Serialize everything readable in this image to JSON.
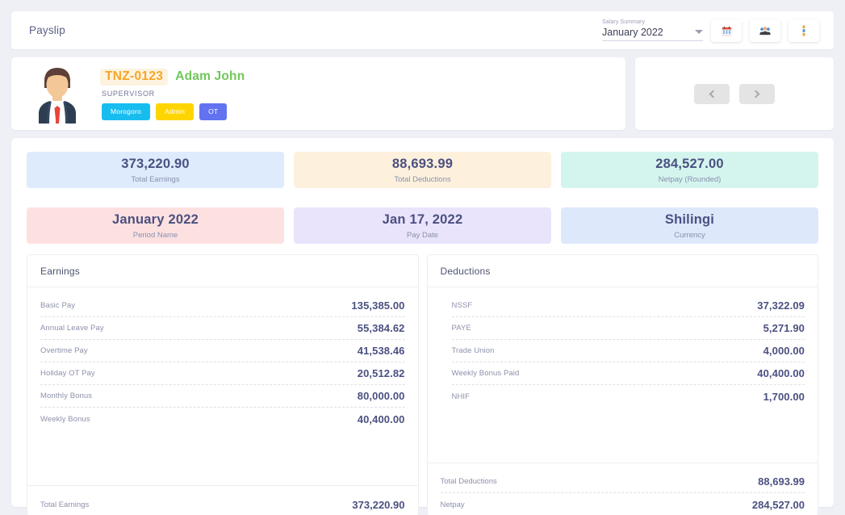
{
  "topbar": {
    "title": "Payslip",
    "select": {
      "label": "Salary Summary",
      "value": "January 2022"
    },
    "buttons": [
      {
        "name": "calendar-button",
        "icon": "calendar-icon"
      },
      {
        "name": "employees-button",
        "icon": "people-group-icon"
      },
      {
        "name": "more-options-button",
        "icon": "vertical-dots-icon"
      }
    ]
  },
  "employee": {
    "code": "TNZ-0123",
    "name": "Adam John",
    "role": "SUPERVISOR",
    "chips": [
      {
        "label": "Morogoro",
        "color": "#18bdf0"
      },
      {
        "label": "Admin",
        "color": "#ffd500"
      },
      {
        "label": "OT",
        "color": "#6272f0"
      }
    ],
    "avatar": "employee-avatar"
  },
  "pager": {
    "prev": "previous-record",
    "next": "next-record"
  },
  "tiles": [
    {
      "value": "373,220.90",
      "label": "Total Earnings",
      "bg": "#ddebfd"
    },
    {
      "value": "88,693.99",
      "label": "Total Deductions",
      "bg": "#fdf1dd"
    },
    {
      "value": "284,527.00",
      "label": "Netpay (Rounded)",
      "bg": "#d4f5ee"
    },
    {
      "value": "January 2022",
      "label": "Period Name",
      "bg": "#fde1e1"
    },
    {
      "value": "Jan 17, 2022",
      "label": "Pay Date",
      "bg": "#e9e4fb"
    },
    {
      "value": "Shilingi",
      "label": "Currency",
      "bg": "#dde8fb"
    }
  ],
  "earnings": {
    "title": "Earnings",
    "rows": [
      {
        "label": "Basic Pay",
        "value": "135,385.00"
      },
      {
        "label": "Annual Leave Pay",
        "value": "55,384.62"
      },
      {
        "label": "Overtime Pay",
        "value": "41,538.46"
      },
      {
        "label": "Holiday OT Pay",
        "value": "20,512.82"
      },
      {
        "label": "Monthly Bonus",
        "value": "80,000.00"
      },
      {
        "label": "Weekly Bonus",
        "value": "40,400.00"
      }
    ],
    "totals": [
      {
        "label": "Total Earnings",
        "value": "373,220.90"
      }
    ]
  },
  "deductions": {
    "title": "Deductions",
    "rows": [
      {
        "label": "NSSF",
        "value": "37,322.09"
      },
      {
        "label": "PAYE",
        "value": "5,271.90"
      },
      {
        "label": "Trade Union",
        "value": "4,000.00"
      },
      {
        "label": "Weekly Bonus Paid",
        "value": "40,400.00"
      },
      {
        "label": "NHIF",
        "value": "1,700.00"
      }
    ],
    "totals": [
      {
        "label": "Total Deductions",
        "value": "88,693.99"
      },
      {
        "label": "Netpay",
        "value": "284,527.00"
      }
    ]
  }
}
